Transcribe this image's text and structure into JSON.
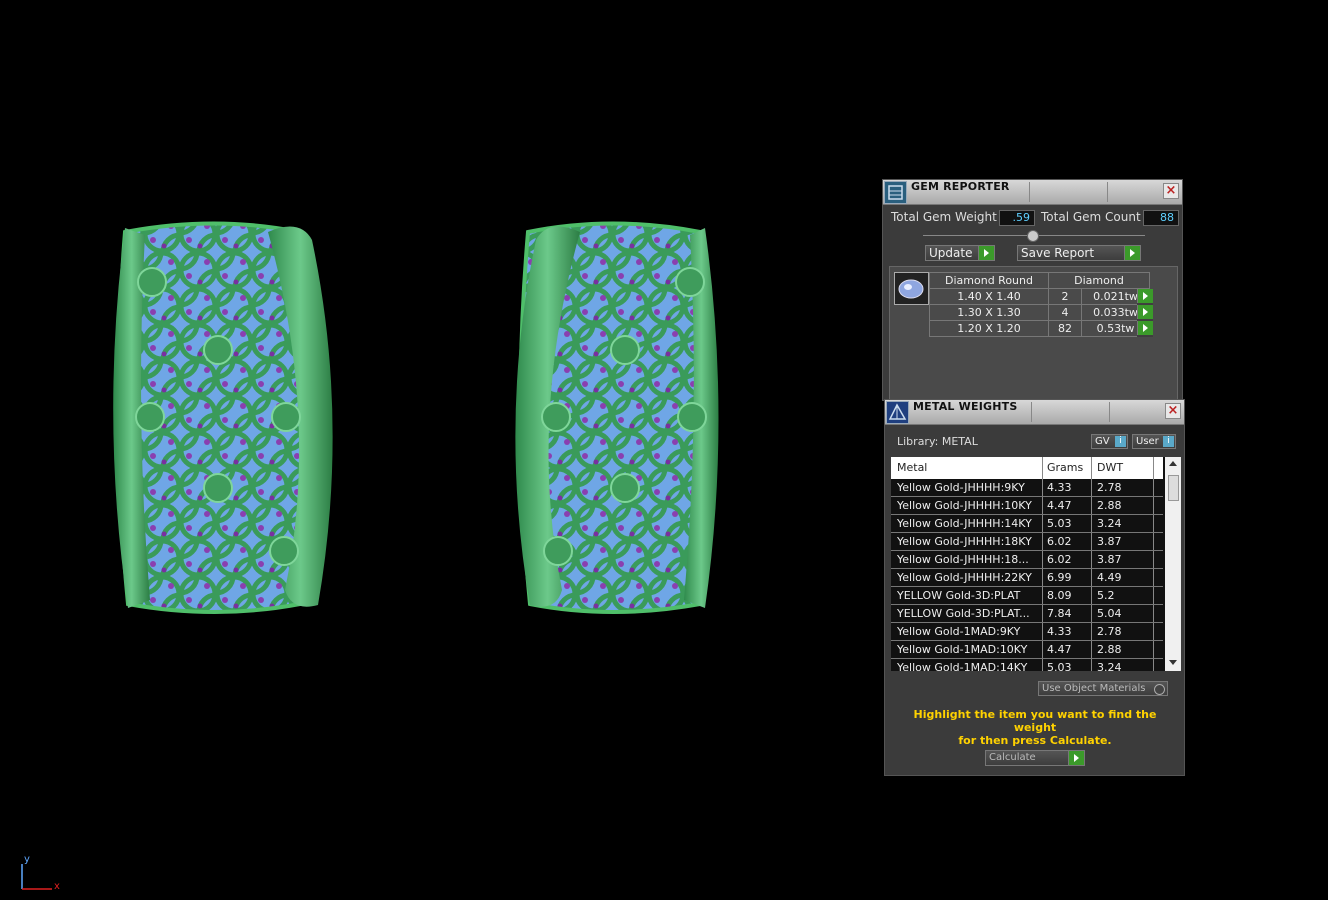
{
  "viewport": {
    "axis": {
      "y_label": "y",
      "x_label": "x"
    }
  },
  "gem_reporter": {
    "title": "GEM REPORTER",
    "total_gem_weight_label": "Total Gem Weight",
    "total_gem_weight_value": ".59",
    "total_gem_count_label": "Total Gem Count",
    "total_gem_count_value": "88",
    "update_label": "Update",
    "save_report_label": "Save Report",
    "table": {
      "headers": [
        "Diamond Round",
        "Diamond"
      ],
      "rows": [
        {
          "size": "1.40 X 1.40",
          "count": "2",
          "tw": "0.021tw"
        },
        {
          "size": "1.30 X 1.30",
          "count": "4",
          "tw": "0.033tw"
        },
        {
          "size": "1.20 X 1.20",
          "count": "82",
          "tw": "0.53tw"
        }
      ]
    },
    "icons": {
      "panel": "gem-reporter-icon",
      "close": "close-icon",
      "gem": "diamond-icon"
    }
  },
  "metal_weights": {
    "title": "METAL WEIGHTS",
    "library_label": "Library: METAL",
    "gv_label": "GV",
    "user_label": "User",
    "columns": [
      "Metal",
      "Grams",
      "DWT"
    ],
    "rows": [
      {
        "metal": "Yellow Gold-JHHHH:9KY",
        "grams": "4.33",
        "dwt": "2.78"
      },
      {
        "metal": "Yellow Gold-JHHHH:10KY",
        "grams": "4.47",
        "dwt": "2.88"
      },
      {
        "metal": "Yellow Gold-JHHHH:14KY",
        "grams": "5.03",
        "dwt": "3.24"
      },
      {
        "metal": "Yellow Gold-JHHHH:18KY",
        "grams": "6.02",
        "dwt": "3.87"
      },
      {
        "metal": "Yellow Gold-JHHHH:18...",
        "grams": "6.02",
        "dwt": "3.87"
      },
      {
        "metal": "Yellow Gold-JHHHH:22KY",
        "grams": "6.99",
        "dwt": "4.49"
      },
      {
        "metal": "YELLOW Gold-3D:PLAT",
        "grams": "8.09",
        "dwt": "5.2"
      },
      {
        "metal": "YELLOW Gold-3D:PLAT...",
        "grams": "7.84",
        "dwt": "5.04"
      },
      {
        "metal": "Yellow Gold-1MAD:9KY",
        "grams": "4.33",
        "dwt": "2.78"
      },
      {
        "metal": "Yellow Gold-1MAD:10KY",
        "grams": "4.47",
        "dwt": "2.88"
      },
      {
        "metal": "Yellow Gold-1MAD:14KY",
        "grams": "5.03",
        "dwt": "3.24"
      }
    ],
    "use_object_materials_label": "Use Object Materials",
    "hint_line1": "Highlight the item you want to find the weight",
    "hint_line2": "for then press Calculate.",
    "calculate_label": "Calculate"
  }
}
